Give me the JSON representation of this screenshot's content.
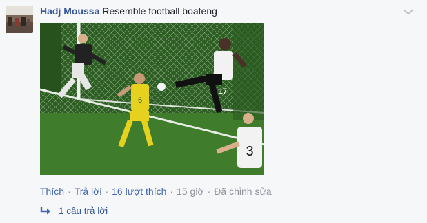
{
  "comment": {
    "author": "Hadj Moussa",
    "text": "Resemble football boateng",
    "photo": {
      "jersey_numbers": [
        "17",
        "3",
        "6"
      ]
    },
    "actions": {
      "like": "Thích",
      "reply": "Trả lời",
      "like_count": "16 lượt thích",
      "time": "15 giờ",
      "edited": "Đã chỉnh sửa"
    },
    "replies_label": "1 câu trả lời"
  },
  "colors": {
    "author_link": "#365899",
    "action_link": "#4267b2",
    "meta_gray": "#90949c",
    "background": "#f6f7f9",
    "pitch_green": "#3f7d2c"
  },
  "icons": {
    "options": "chevron-down-icon",
    "reply_arrow": "reply-arrow-icon"
  }
}
